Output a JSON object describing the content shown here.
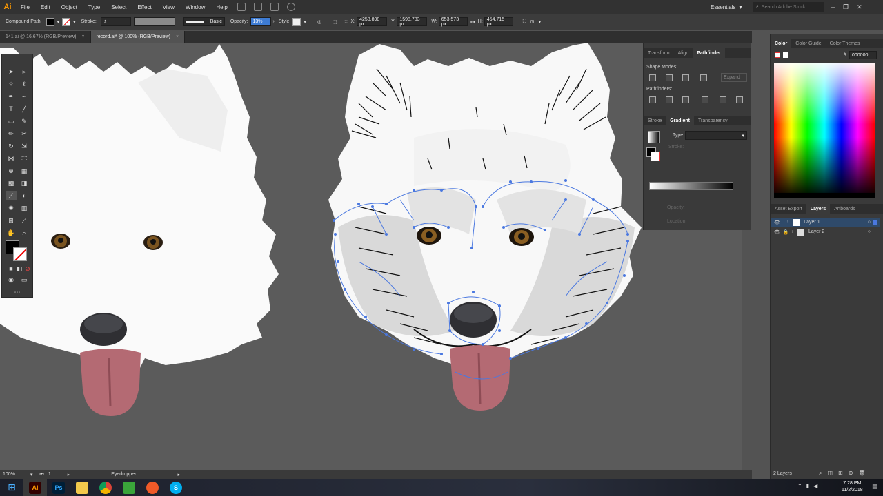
{
  "menubar": {
    "app_logo": "Ai",
    "items": [
      "File",
      "Edit",
      "Object",
      "Type",
      "Select",
      "Effect",
      "View",
      "Window",
      "Help"
    ],
    "workspace": "Essentials",
    "search_placeholder": "Search Adobe Stock"
  },
  "controlbar": {
    "selection_type": "Compound Path",
    "stroke_label": "Stroke:",
    "brush_label": "Basic",
    "opacity_label": "Opacity:",
    "opacity_value": "13%",
    "style_label": "Style:",
    "x_label": "X:",
    "x_value": "4258.898 px",
    "y_label": "Y:",
    "y_value": "1598.783 px",
    "w_label": "W:",
    "w_value": "653.573 px",
    "h_label": "H:",
    "h_value": "454.715 px"
  },
  "tabs": [
    {
      "label": "141.ai @ 16.67% (RGB/Preview)",
      "active": false
    },
    {
      "label": "record.ai* @ 100% (RGB/Preview)",
      "active": true
    }
  ],
  "statusbar": {
    "zoom": "100%",
    "artboard": "1",
    "tool": "Eyedropper"
  },
  "midpanel": {
    "tabs1": [
      "Transform",
      "Align",
      "Pathfinder"
    ],
    "shape_modes_label": "Shape Modes:",
    "expand_label": "Expand",
    "pathfinders_label": "Pathfinders:",
    "tabs2": [
      "Stroke",
      "Gradient",
      "Transparency"
    ],
    "type_label": "Type:",
    "stroke_sub": "Stroke:",
    "opacity_label": "Opacity:",
    "location_label": "Location:"
  },
  "rightpanel": {
    "color_tabs": [
      "Color",
      "Color Guide",
      "Color Themes"
    ],
    "hex_value": "000000",
    "layer_tabs": [
      "Asset Export",
      "Layers",
      "Artboards"
    ],
    "layers": [
      "Layer 1",
      "Layer 2"
    ],
    "layer_count": "2 Layers"
  },
  "taskbar": {
    "time": "7:28 PM",
    "date": "11/2/2018"
  },
  "colors": {
    "accent": "#3d7bd3",
    "ai_orange": "#ff9a00",
    "path_blue": "#4a78e0"
  }
}
